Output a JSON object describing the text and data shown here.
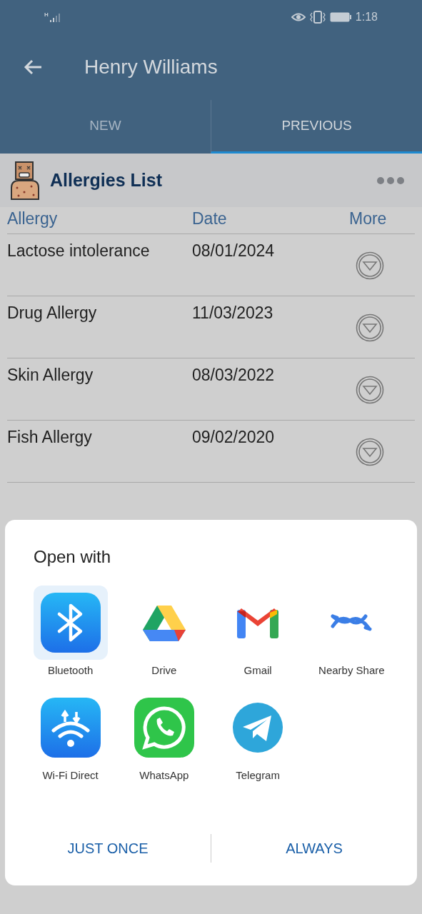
{
  "status_bar": {
    "network": "H",
    "time": "1:18"
  },
  "toolbar": {
    "title": "Henry Williams"
  },
  "tabs": [
    {
      "label": "NEW",
      "selected": false
    },
    {
      "label": "PREVIOUS",
      "selected": true
    }
  ],
  "list_header": {
    "title": "Allergies List"
  },
  "table": {
    "columns": [
      "Allergy",
      "Date",
      "More"
    ],
    "rows": [
      {
        "allergy": "Lactose intolerance",
        "date": "08/01/2024"
      },
      {
        "allergy": "Drug Allergy",
        "date": "11/03/2023"
      },
      {
        "allergy": "Skin Allergy",
        "date": "08/03/2022"
      },
      {
        "allergy": "Fish Allergy",
        "date": "09/02/2020"
      }
    ]
  },
  "dialog": {
    "title": "Open with",
    "apps": [
      {
        "label": "Bluetooth",
        "selected": true
      },
      {
        "label": "Drive",
        "selected": false
      },
      {
        "label": "Gmail",
        "selected": false
      },
      {
        "label": "Nearby Share",
        "selected": false
      },
      {
        "label": "Wi-Fi Direct",
        "selected": false
      },
      {
        "label": "WhatsApp",
        "selected": false
      },
      {
        "label": "Telegram",
        "selected": false
      }
    ],
    "buttons": [
      "JUST ONCE",
      "ALWAYS"
    ]
  }
}
